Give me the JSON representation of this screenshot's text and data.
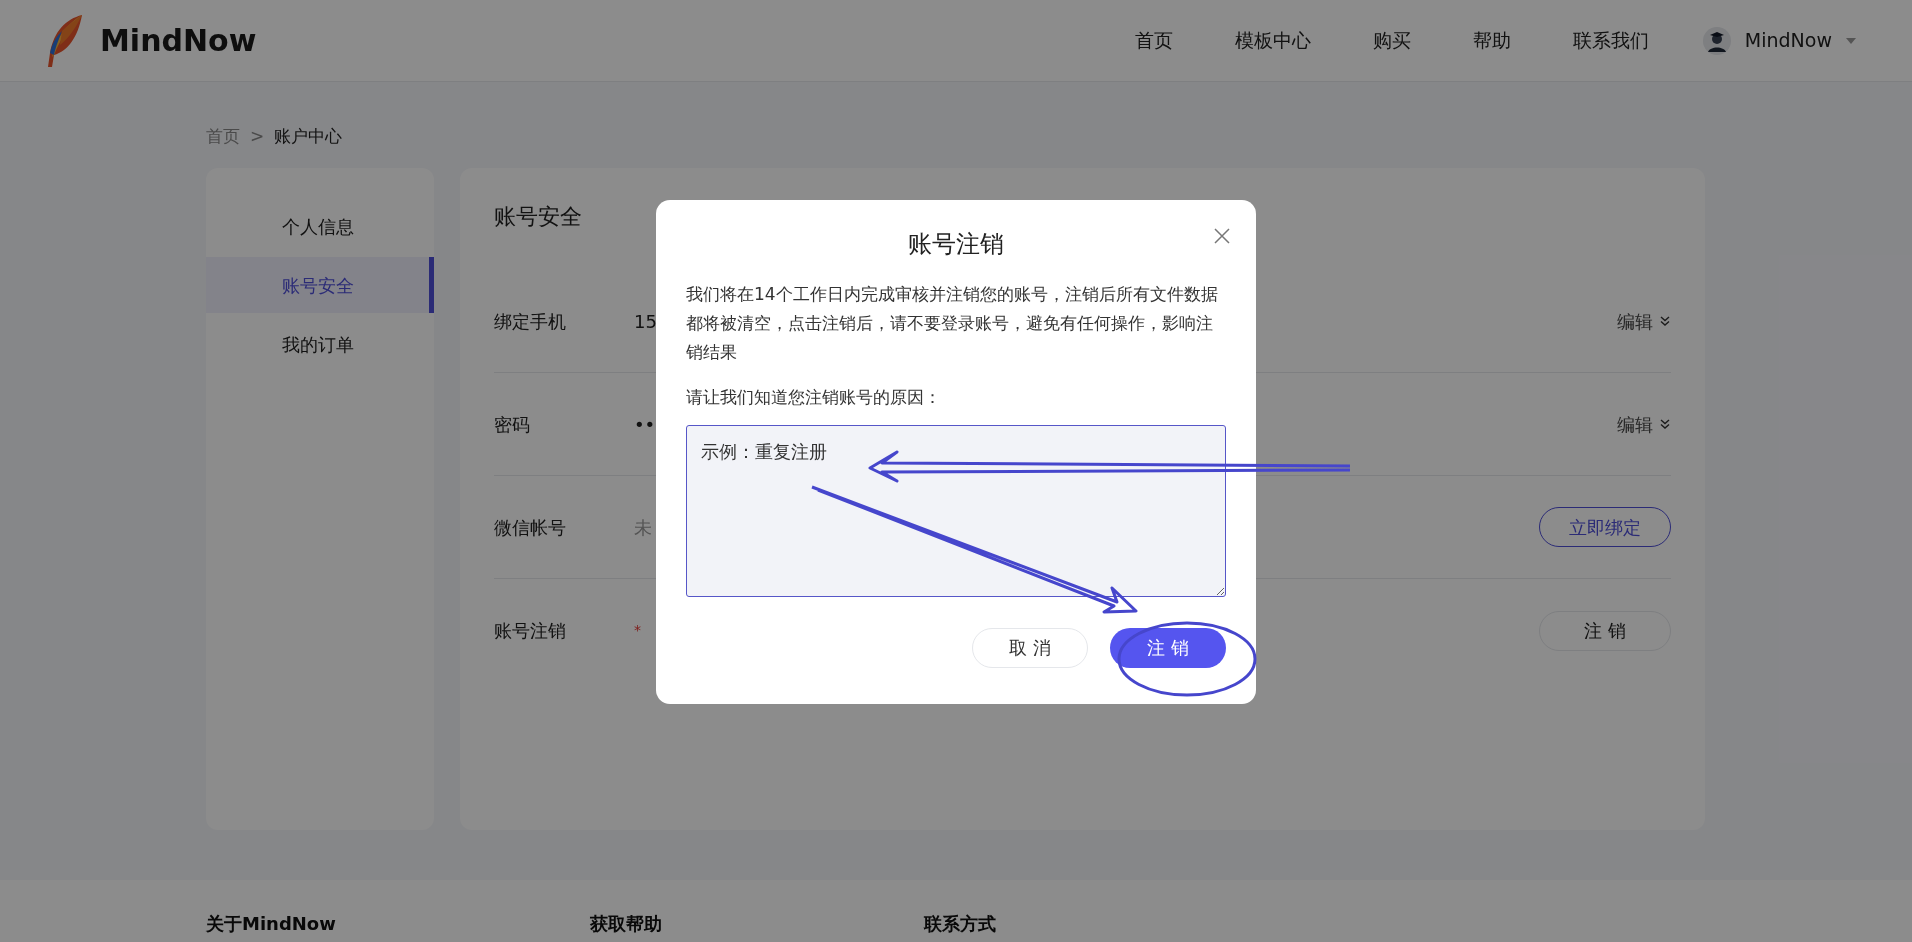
{
  "header": {
    "logo_text": "MindNow",
    "nav": [
      "首页",
      "模板中心",
      "购买",
      "帮助",
      "联系我们"
    ],
    "user": {
      "name": "MindNow"
    }
  },
  "breadcrumb": {
    "items": [
      "首页",
      "账户中心"
    ],
    "separator": ">"
  },
  "sidebar": {
    "items": [
      {
        "label": "个人信息",
        "selected": false
      },
      {
        "label": "账号安全",
        "selected": true
      },
      {
        "label": "我的订单",
        "selected": false
      }
    ]
  },
  "panel": {
    "title": "账号安全",
    "rows": [
      {
        "label": "绑定手机",
        "value": "15",
        "value_muted": false,
        "action": {
          "kind": "link",
          "label": "编辑"
        }
      },
      {
        "label": "密码",
        "value": "••",
        "value_muted": false,
        "action": {
          "kind": "link",
          "label": "编辑"
        }
      },
      {
        "label": "微信帐号",
        "value": "未",
        "value_muted": true,
        "action": {
          "kind": "accent-outline",
          "label": "立即绑定"
        }
      },
      {
        "label": "账号注销",
        "marker": "*",
        "action": {
          "kind": "outline",
          "label": "注 销"
        }
      }
    ]
  },
  "modal": {
    "title": "账号注销",
    "message": "我们将在14个工作日内完成审核并注销您的账号，注销后所有文件数据都将被清空，点击注销后，请不要登录账号，避免有任何操作，影响注销结果",
    "prompt": "请让我们知道您注销账号的原因：",
    "reason_value": "示例：重复注册",
    "buttons": [
      {
        "label": "取 消",
        "kind": "secondary"
      },
      {
        "label": "注 销",
        "kind": "primary"
      }
    ]
  },
  "footer": {
    "headings": [
      "关于MindNow",
      "获取帮助",
      "联系方式"
    ]
  }
}
